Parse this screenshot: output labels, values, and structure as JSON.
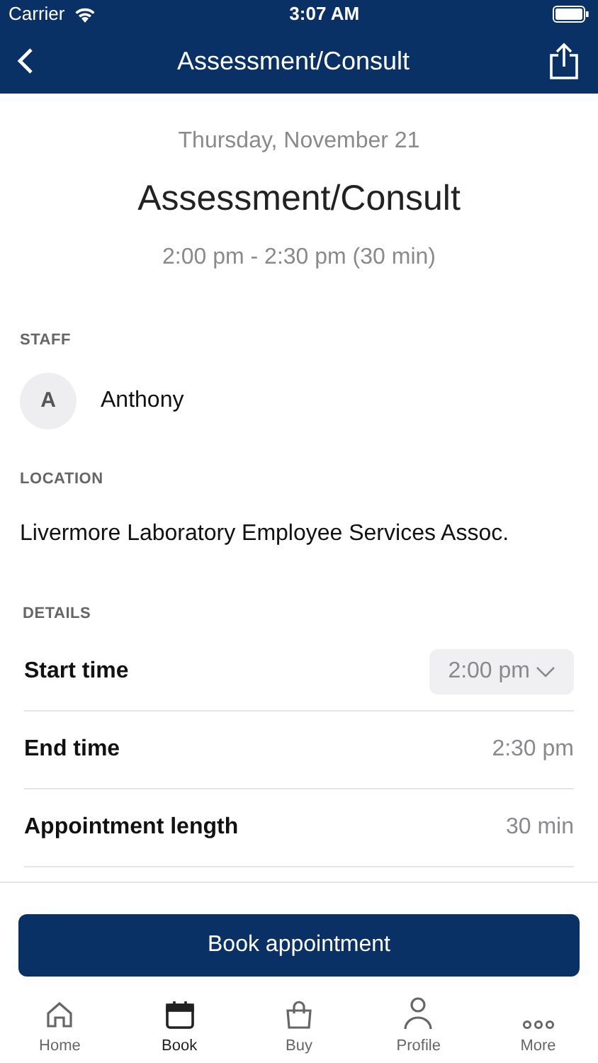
{
  "status_bar": {
    "carrier": "Carrier",
    "time": "3:07 AM"
  },
  "nav_bar": {
    "title": "Assessment/Consult"
  },
  "header": {
    "date": "Thursday, November 21",
    "title": "Assessment/Consult",
    "time_range": "2:00 pm - 2:30 pm (30 min)"
  },
  "staff": {
    "label": "STAFF",
    "initial": "A",
    "name": "Anthony"
  },
  "location": {
    "label": "LOCATION",
    "name": "Livermore Laboratory Employee Services Assoc."
  },
  "details": {
    "label": "DETAILS",
    "rows": [
      {
        "kind": "select",
        "label": "Start time",
        "value": "2:00 pm"
      },
      {
        "kind": "text",
        "label": "End time",
        "value": "2:30 pm"
      },
      {
        "kind": "text",
        "label": "Appointment length",
        "value": "30 min"
      }
    ]
  },
  "book_button": "Book appointment",
  "tab_bar": [
    {
      "label": "Home",
      "selected": false
    },
    {
      "label": "Book",
      "selected": true
    },
    {
      "label": "Buy",
      "selected": false
    },
    {
      "label": "Profile",
      "selected": false
    },
    {
      "label": "More",
      "selected": false
    }
  ]
}
